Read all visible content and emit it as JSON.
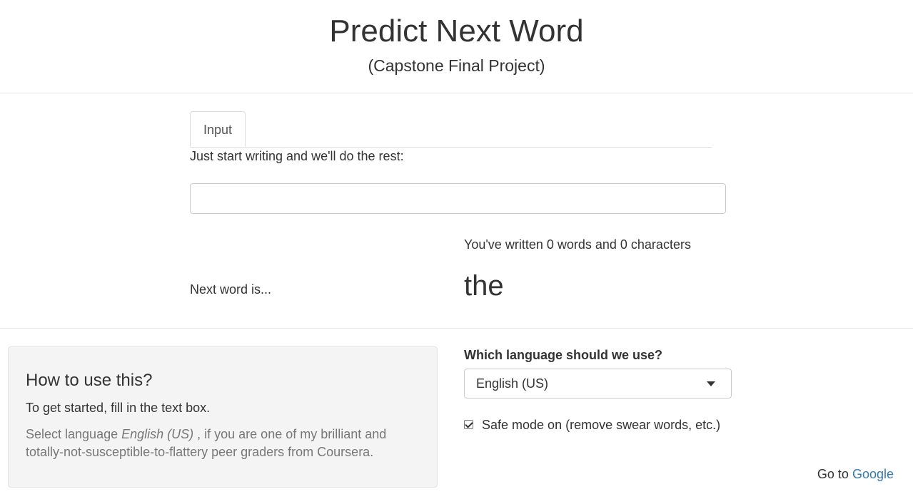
{
  "header": {
    "title": "Predict Next Word",
    "subtitle": "(Capstone Final Project)"
  },
  "tabs": [
    {
      "label": "Input",
      "active": true
    }
  ],
  "input": {
    "prompt": "Just start writing and we'll do the rest:",
    "value": "",
    "placeholder": ""
  },
  "stats": {
    "text": "You've written 0 words and 0 characters"
  },
  "prediction": {
    "label": "Next word is...",
    "word": "the"
  },
  "help": {
    "title": "How to use this?",
    "line1": "To get started, fill in the text box.",
    "line2_pre": "Select language ",
    "line2_em": "English (US)",
    "line2_post": " , if you are one of my brilliant and totally-not-susceptible-to-flattery peer graders from Coursera."
  },
  "language": {
    "label": "Which language should we use?",
    "selected": "English (US)"
  },
  "safe_mode": {
    "label": "Safe mode on (remove swear words, etc.)",
    "checked": true
  },
  "footer": {
    "prefix": "Go to ",
    "link_text": "Google"
  },
  "colors": {
    "link": "#337ab7",
    "muted_text": "#777777",
    "well_bg": "#f4f4f4"
  }
}
